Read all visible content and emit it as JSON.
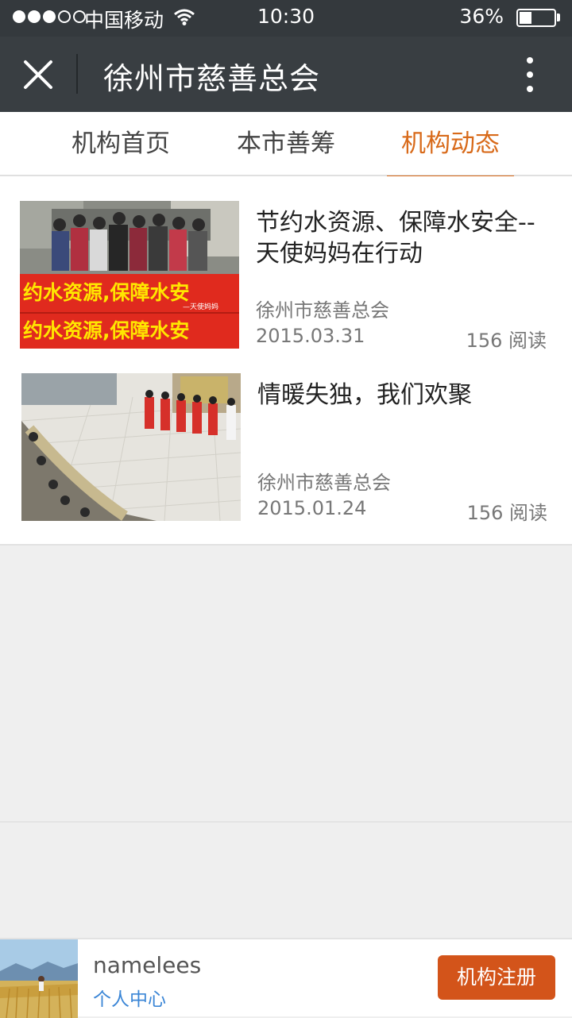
{
  "status_bar": {
    "carrier": "中国移动",
    "time": "10:30",
    "battery": "36%",
    "battery_level": 0.36,
    "signal_bars": 3,
    "signal_total": 5
  },
  "header": {
    "title": "徐州市慈善总会",
    "close_icon": "close-icon",
    "more_icon": "more-vertical-icon"
  },
  "tabs": [
    {
      "label": "机构首页",
      "active": false
    },
    {
      "label": "本市善筹",
      "active": false
    },
    {
      "label": "机构动态",
      "active": true
    }
  ],
  "articles": [
    {
      "title": "节约水资源、保障水安全--天使妈妈在行动",
      "source": "徐州市慈善总会",
      "date": "2015.03.31",
      "reads": "156 阅读",
      "banner_text": "约水资源,保障水安",
      "banner_caption": "—天使妈妈"
    },
    {
      "title": "情暖失独，我们欢聚",
      "source": "徐州市慈善总会",
      "date": "2015.01.24",
      "reads": "156 阅读"
    }
  ],
  "footer": {
    "username": "namelees",
    "profile_link": "个人中心",
    "register_button": "机构注册"
  },
  "colors": {
    "accent": "#d86a1a",
    "register": "#d3541a",
    "link": "#3b86d6",
    "header_bg": "#393e42",
    "status_bg": "#34393d"
  }
}
